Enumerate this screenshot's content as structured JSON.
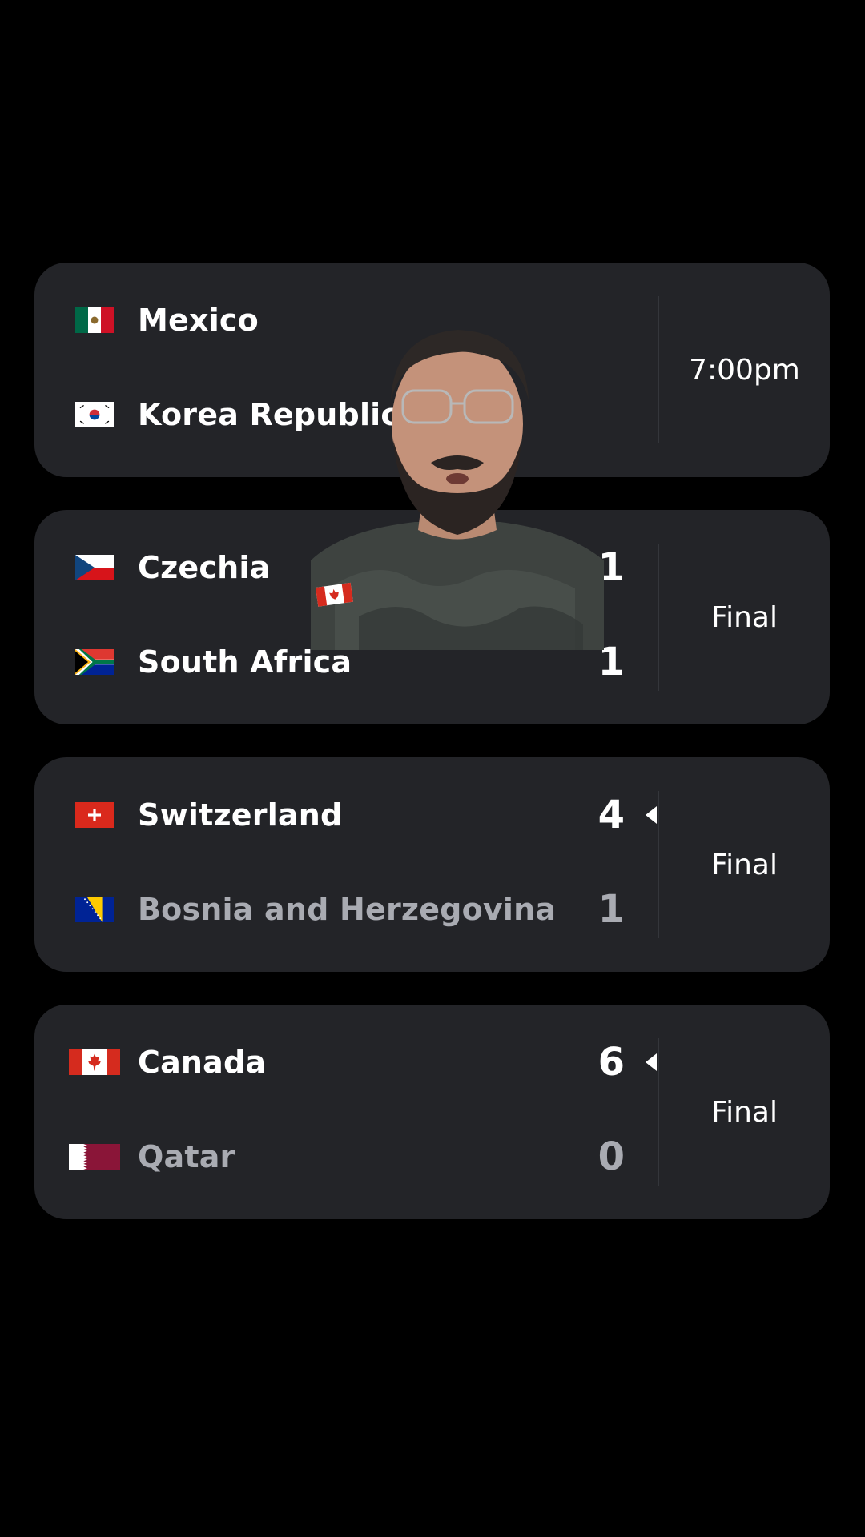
{
  "matches": [
    {
      "home": {
        "name": "Mexico",
        "flag": "mexico-flag",
        "score": "",
        "winner": false,
        "loser": false
      },
      "away": {
        "name": "Korea Republic",
        "flag": "korea-flag",
        "score": "",
        "winner": false,
        "loser": false
      },
      "status": "7:00pm"
    },
    {
      "home": {
        "name": "Czechia",
        "flag": "czechia-flag",
        "score": "1",
        "winner": false,
        "loser": false
      },
      "away": {
        "name": "South Africa",
        "flag": "south-africa-flag",
        "score": "1",
        "winner": false,
        "loser": false
      },
      "status": "Final"
    },
    {
      "home": {
        "name": "Switzerland",
        "flag": "switzerland-flag",
        "score": "4",
        "winner": true,
        "loser": false
      },
      "away": {
        "name": "Bosnia and Herzegovina",
        "flag": "bosnia-flag",
        "score": "1",
        "winner": false,
        "loser": true
      },
      "status": "Final"
    },
    {
      "home": {
        "name": "Canada",
        "flag": "canada-flag",
        "score": "6",
        "winner": true,
        "loser": false
      },
      "away": {
        "name": "Qatar",
        "flag": "qatar-flag",
        "score": "0",
        "winner": false,
        "loser": true
      },
      "status": "Final"
    }
  ],
  "colors": {
    "background": "#000000",
    "card": "#232428",
    "text_primary": "#ffffff",
    "text_muted": "#a9abb2"
  }
}
